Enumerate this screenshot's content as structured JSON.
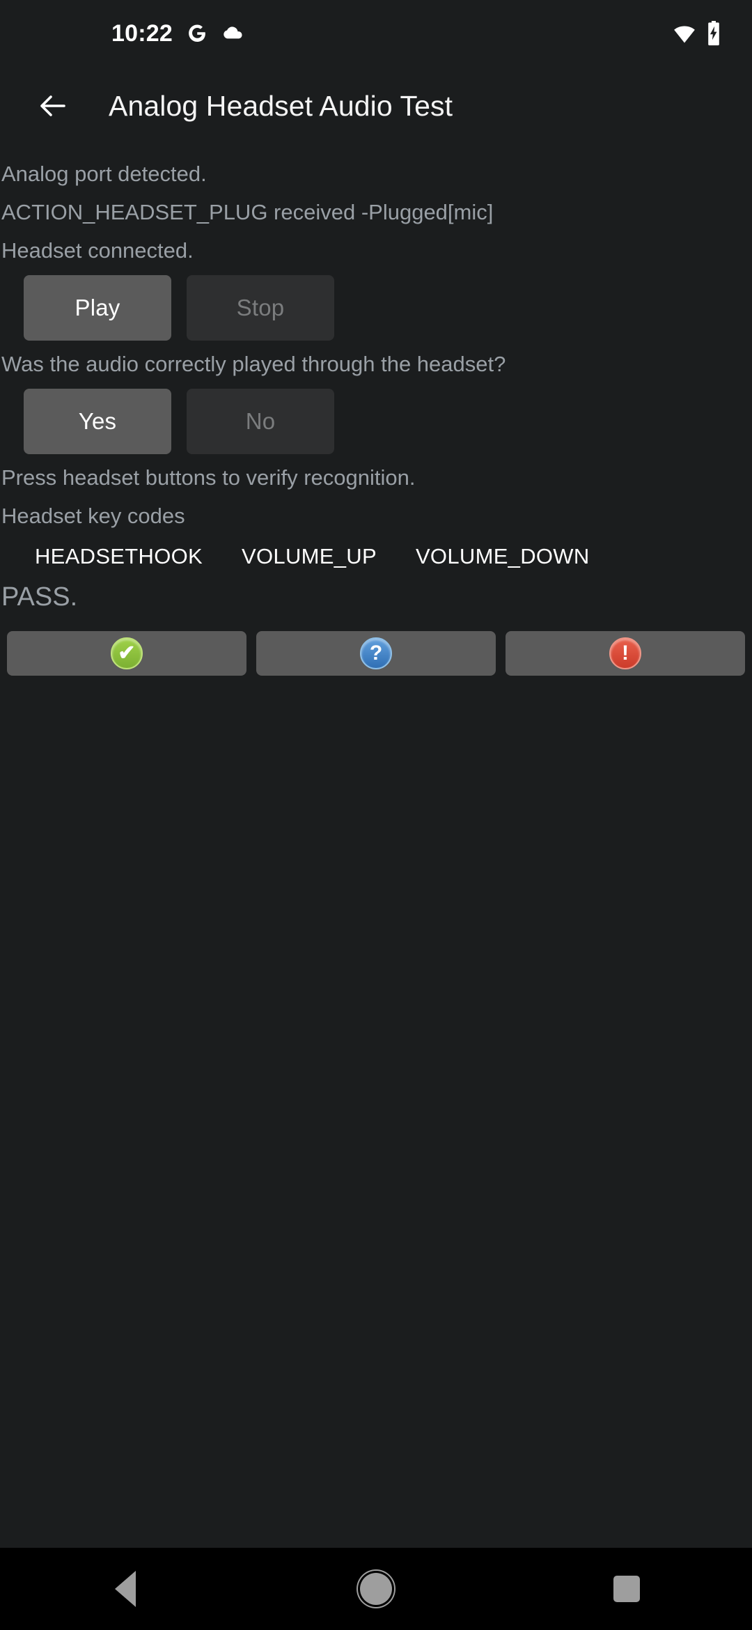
{
  "status_bar": {
    "clock": "10:22",
    "icons_left": [
      "google-g-icon",
      "cloud-icon"
    ],
    "icons_right": [
      "wifi-icon",
      "battery-charging-icon"
    ]
  },
  "app_bar": {
    "back_icon": "back-arrow-icon",
    "title": "Analog Headset Audio Test"
  },
  "content": {
    "log_lines": [
      "Analog port detected.",
      "ACTION_HEADSET_PLUG received -Plugged[mic]",
      "Headset connected."
    ],
    "playback_controls": {
      "play_label": "Play",
      "stop_label": "Stop"
    },
    "question": "Was the audio correctly played through the headset?",
    "answers": {
      "yes_label": "Yes",
      "no_label": "No"
    },
    "instruction": "Press headset buttons to verify recognition.",
    "keycodes_heading": "Headset key codes",
    "keycodes": [
      "HEADSETHOOK",
      "VOLUME_UP",
      "VOLUME_DOWN"
    ],
    "verdict": "PASS."
  },
  "result_buttons": [
    {
      "name": "pass-button",
      "icon": "checkmark-icon",
      "glyph": "✔",
      "color": "#8cc63f"
    },
    {
      "name": "info-button",
      "icon": "question-mark-icon",
      "glyph": "?",
      "color": "#4a8fd0"
    },
    {
      "name": "fail-button",
      "icon": "exclamation-icon",
      "glyph": "!",
      "color": "#d9432f"
    }
  ],
  "nav_bar": {
    "back": "back-nav-icon",
    "home": "home-nav-icon",
    "recents": "recents-nav-icon"
  },
  "colors": {
    "background": "#1b1d1e",
    "button_enabled": "#5b5b5b",
    "button_disabled": "#2e2f30",
    "text_secondary": "#9aa0a6",
    "text_primary": "#ffffff",
    "nav_background": "#000000"
  }
}
